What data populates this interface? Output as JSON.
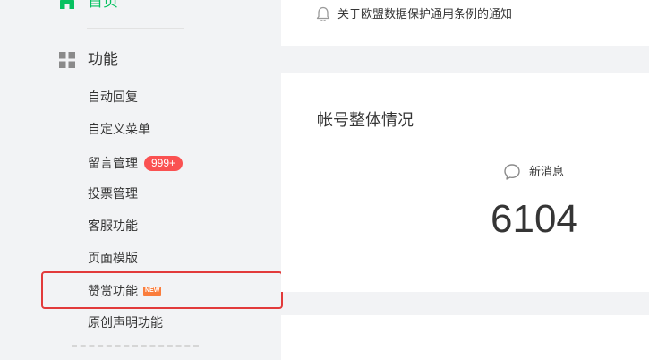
{
  "sidebar": {
    "home": {
      "label": "首页",
      "icon": "home-icon",
      "color": "#07c160"
    },
    "section": {
      "label": "功能",
      "icon": "grid-icon"
    },
    "items": [
      {
        "label": "自动回复"
      },
      {
        "label": "自定义菜单"
      },
      {
        "label": "留言管理",
        "badge": "999+"
      },
      {
        "label": "投票管理"
      },
      {
        "label": "客服功能"
      },
      {
        "label": "页面模版"
      },
      {
        "label": "赞赏功能",
        "tag": "NEW",
        "highlighted": true
      },
      {
        "label": "原创声明功能"
      }
    ],
    "badge_color": "#fa5151",
    "highlight_color": "#e23a3a"
  },
  "notice": {
    "icon": "bell-icon",
    "text": "关于欧盟数据保护通用条例的通知"
  },
  "stats": {
    "title": "帐号整体情况",
    "new_messages": {
      "icon": "chat-icon",
      "label": "新消息",
      "count": "6104"
    }
  }
}
